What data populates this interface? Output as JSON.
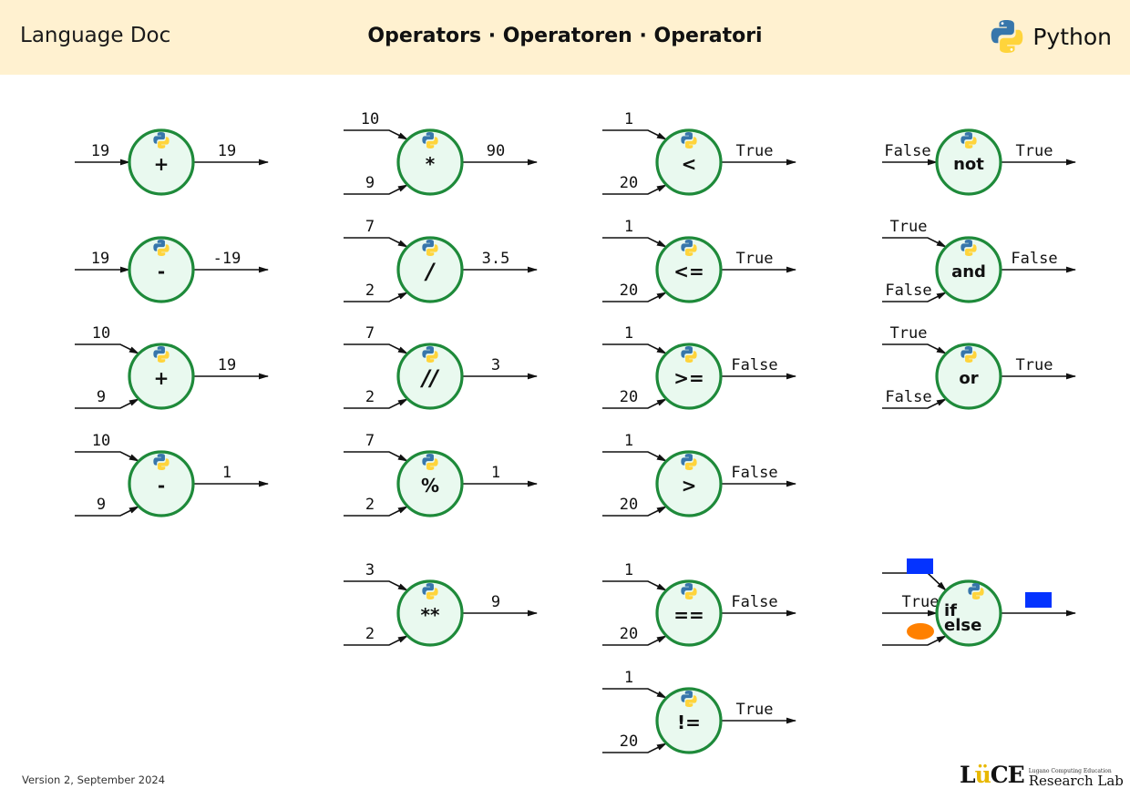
{
  "header": {
    "left_title": "Language Doc",
    "center_title": "Operators · Operatoren · Operatori",
    "language": "Python",
    "logo_icon": "python-logo-icon"
  },
  "footer": {
    "version": "Version 2, September 2024",
    "lab_mark_prefix": "L",
    "lab_mark_u": "ü",
    "lab_mark_suffix": "CE",
    "lab_small": "Lugano Computing Education",
    "lab_big": "Research Lab"
  },
  "colors": {
    "header_bg": "#fff1d0",
    "node_fill": "#e9f9ef",
    "node_stroke": "#1e8a3a",
    "blue_value": "#0433ff",
    "orange_value": "#ff8000"
  },
  "operators": [
    {
      "id": "unary-plus",
      "op": "+",
      "inputs": [
        "19"
      ],
      "output": "19"
    },
    {
      "id": "unary-minus",
      "op": "-",
      "inputs": [
        "19"
      ],
      "output": "-19"
    },
    {
      "id": "add",
      "op": "+",
      "inputs": [
        "10",
        "9"
      ],
      "output": "19"
    },
    {
      "id": "subtract",
      "op": "-",
      "inputs": [
        "10",
        "9"
      ],
      "output": "1"
    },
    {
      "id": "multiply",
      "op": "*",
      "inputs": [
        "10",
        "9"
      ],
      "output": "90"
    },
    {
      "id": "divide",
      "op": "/",
      "inputs": [
        "7",
        "2"
      ],
      "output": "3.5"
    },
    {
      "id": "floor-divide",
      "op": "//",
      "inputs": [
        "7",
        "2"
      ],
      "output": "3"
    },
    {
      "id": "modulo",
      "op": "%",
      "inputs": [
        "7",
        "2"
      ],
      "output": "1"
    },
    {
      "id": "power",
      "op": "**",
      "inputs": [
        "3",
        "2"
      ],
      "output": "9"
    },
    {
      "id": "less-than",
      "op": "<",
      "inputs": [
        "1",
        "20"
      ],
      "output": "True"
    },
    {
      "id": "less-equal",
      "op": "<=",
      "inputs": [
        "1",
        "20"
      ],
      "output": "True"
    },
    {
      "id": "greater-equal",
      "op": ">=",
      "inputs": [
        "1",
        "20"
      ],
      "output": "False"
    },
    {
      "id": "greater-than",
      "op": ">",
      "inputs": [
        "1",
        "20"
      ],
      "output": "False"
    },
    {
      "id": "equal",
      "op": "==",
      "inputs": [
        "1",
        "20"
      ],
      "output": "False"
    },
    {
      "id": "not-equal",
      "op": "!=",
      "inputs": [
        "1",
        "20"
      ],
      "output": "True"
    },
    {
      "id": "not",
      "op": "not",
      "inputs": [
        "False"
      ],
      "output": "True"
    },
    {
      "id": "and",
      "op": "and",
      "inputs": [
        "True",
        "False"
      ],
      "output": "False"
    },
    {
      "id": "or",
      "op": "or",
      "inputs": [
        "True",
        "False"
      ],
      "output": "True"
    },
    {
      "id": "if-else",
      "op": "if\nelse",
      "inputs": [
        "blue-rectangle",
        "True",
        "orange-ellipse"
      ],
      "output": "blue-rectangle"
    }
  ]
}
